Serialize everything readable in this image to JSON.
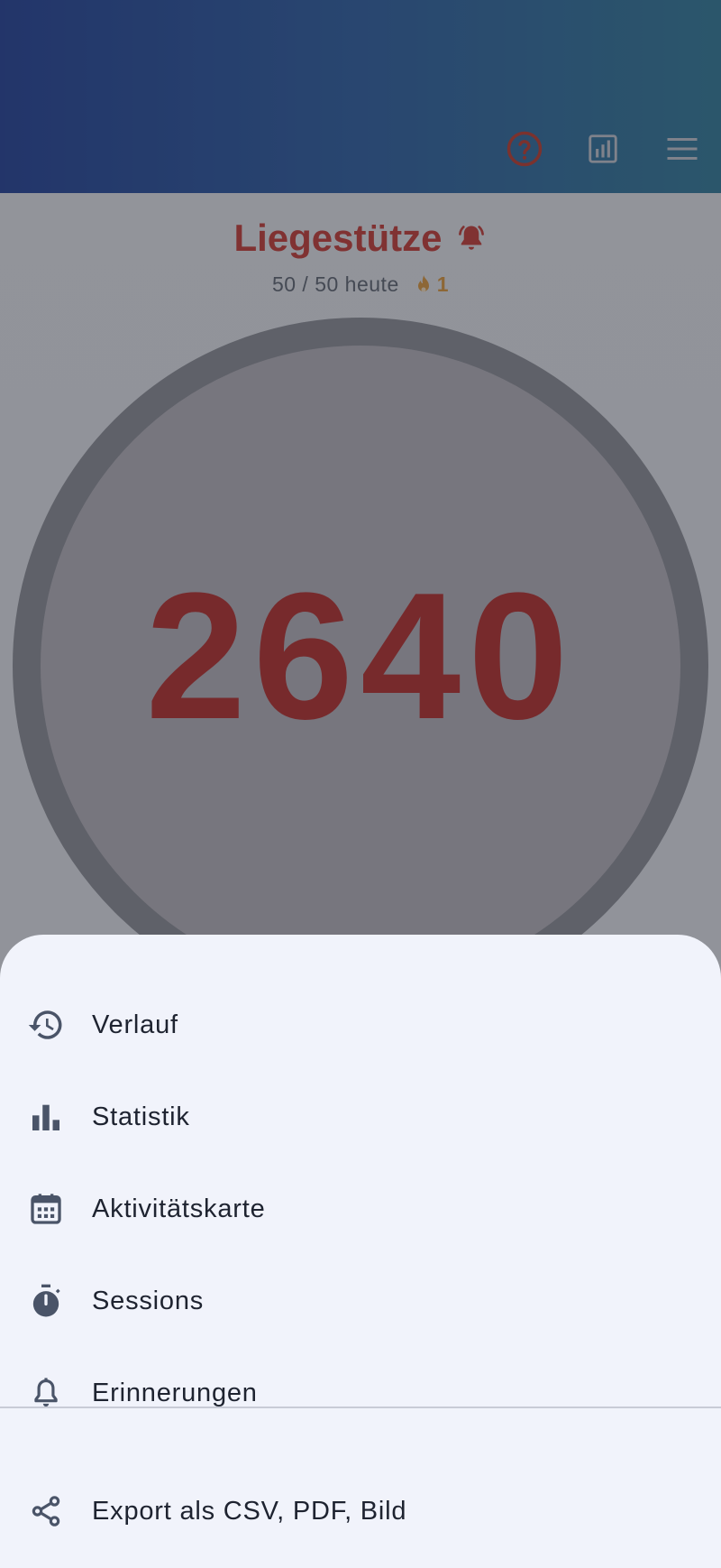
{
  "header": {
    "help_icon": "help-circle-icon",
    "stats_icon": "stats-icon",
    "menu_icon": "hamburger-menu-icon"
  },
  "exercise": {
    "title": "Liegestütze",
    "progress_text": "50 / 50 heute",
    "streak_count": "1",
    "total_count": "2640"
  },
  "menu": {
    "items": [
      {
        "label": "Verlauf",
        "icon": "history-icon"
      },
      {
        "label": "Statistik",
        "icon": "bar-chart-icon"
      },
      {
        "label": "Aktivitätskarte",
        "icon": "calendar-icon"
      },
      {
        "label": "Sessions",
        "icon": "timer-icon"
      },
      {
        "label": "Erinnerungen",
        "icon": "bell-icon"
      },
      {
        "label": "Export als CSV, PDF, Bild",
        "icon": "share-icon"
      }
    ]
  },
  "colors": {
    "accent_red": "#c83a32",
    "header_start": "#1f3f98",
    "header_end": "#2f7b9a",
    "sheet_bg": "#f1f3fb",
    "streak_orange": "#e09a3a"
  }
}
